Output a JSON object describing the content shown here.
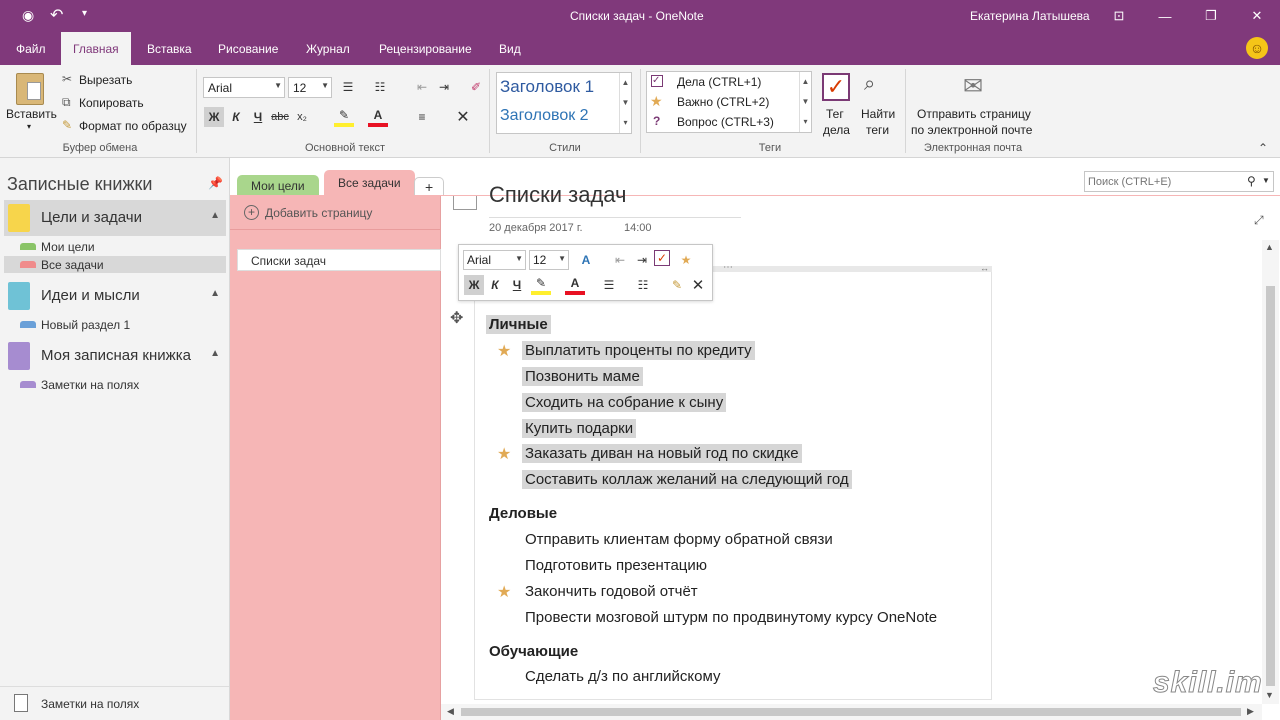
{
  "titlebar": {
    "title": "Списки задач  -  OneNote",
    "user": "Екатерина Латышева"
  },
  "ribbon_tabs": [
    "Файл",
    "Главная",
    "Вставка",
    "Рисование",
    "Журнал",
    "Рецензирование",
    "Вид"
  ],
  "ribbon": {
    "paste": "Вставить",
    "cut": "Вырезать",
    "copy": "Копировать",
    "format_painter": "Формат по образцу",
    "clipboard_group": "Буфер обмена",
    "font_name": "Arial",
    "font_size": "12",
    "bold": "Ж",
    "italic": "К",
    "underline": "Ч",
    "strike": "abc",
    "subscript": "x₂",
    "basic_text_group": "Основной текст",
    "style1": "Заголовок 1",
    "style2": "Заголовок 2",
    "styles_group": "Стили",
    "tag1": "Дела (CTRL+1)",
    "tag2": "Важно (CTRL+2)",
    "tag3": "Вопрос (CTRL+3)",
    "tag_button": "Тег\nдела",
    "tag_btn_l1": "Тег",
    "tag_btn_l2": "дела",
    "find_l1": "Найти",
    "find_l2": "теги",
    "tags_group": "Теги",
    "email_l1": "Отправить страницу",
    "email_l2": "по электронной почте",
    "email_group": "Электронная почта"
  },
  "nav": {
    "title": "Записные книжки",
    "notebooks": [
      {
        "name": "Цели и задачи",
        "color": "#f7d54b"
      },
      {
        "name": "Идеи и мысли",
        "color": "#6fc2d6"
      },
      {
        "name": "Моя записная книжка",
        "color": "#a68cd0"
      }
    ],
    "sections": [
      {
        "name": "Мои цели",
        "color": "#8ac467"
      },
      {
        "name": "Все задачи",
        "color": "#f08c8c"
      },
      {
        "name": "Новый раздел 1",
        "color": "#6aa0d8"
      },
      {
        "name": "Заметки на полях",
        "color": "#a68cd0"
      }
    ],
    "footer": "Заметки на полях"
  },
  "section_tabs": [
    "Мои цели",
    "Все задачи",
    "+"
  ],
  "search": {
    "placeholder": "Поиск (CTRL+E)"
  },
  "pagelist": {
    "add_page": "Добавить страницу",
    "pages": [
      "Списки задач"
    ]
  },
  "page": {
    "title": "Списки задач",
    "date": "20 декабря 2017 г.",
    "time": "14:00"
  },
  "mini_toolbar": {
    "font": "Arial",
    "size": "12"
  },
  "notes": {
    "h1": "Личные",
    "personal": [
      "Выплатить проценты по кредиту",
      "Позвонить маме",
      "Сходить на собрание к сыну",
      "Купить подарки",
      "Заказать диван на новый год по скидке",
      "Составить коллаж желаний на следующий год"
    ],
    "h2": "Деловые",
    "business": [
      "Отправить клиентам форму обратной  связи",
      "Подготовить презентацию",
      "Закончить годовой отчёт",
      "Провести мозговой штурм по продвинутому курсу OneNote"
    ],
    "h3": "Обучающие",
    "study": [
      "Сделать д/з по английскому"
    ]
  },
  "watermark": "skill.im",
  "colors": {
    "accent": "#80397b",
    "pagelist": "#f6b6b6",
    "star": "#e1aa55"
  }
}
